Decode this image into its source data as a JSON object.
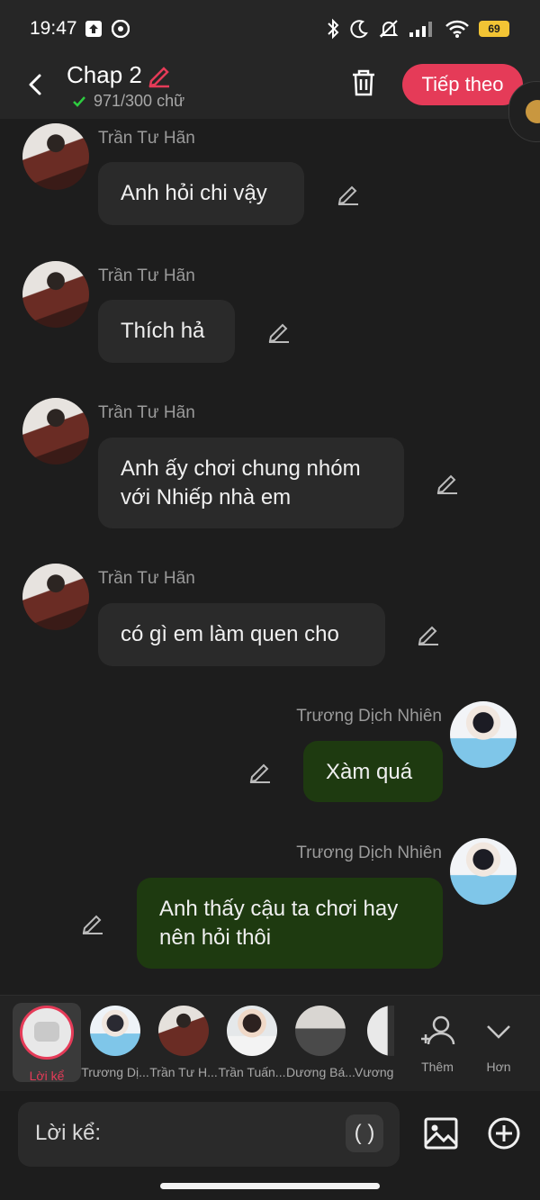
{
  "status_bar": {
    "time": "19:47",
    "battery": "69"
  },
  "header": {
    "title": "Chap 2",
    "word_count": "971/300 chữ",
    "next_label": "Tiếp theo"
  },
  "messages": [
    {
      "sender": "Trần Tư Hãn",
      "text": "Anh hỏi chi vậy",
      "side": "left"
    },
    {
      "sender": "Trần Tư Hãn",
      "text": "Thích hả",
      "side": "left"
    },
    {
      "sender": "Trần Tư Hãn",
      "text": "Anh ấy chơi chung nhóm với Nhiếp nhà em",
      "side": "left"
    },
    {
      "sender": "Trần Tư Hãn",
      "text": "có gì em làm quen cho",
      "side": "left"
    },
    {
      "sender": "Trương Dịch Nhiên",
      "text": "Xàm quá",
      "side": "right"
    },
    {
      "sender": "Trương Dịch Nhiên",
      "text": "Anh thấy cậu ta chơi hay nên hỏi thôi",
      "side": "right"
    }
  ],
  "tray": {
    "items": [
      {
        "label": "Lời kể"
      },
      {
        "label": "Trương Dị..."
      },
      {
        "label": "Trần Tư H..."
      },
      {
        "label": "Trần Tuấn..."
      },
      {
        "label": "Dương Bá..."
      },
      {
        "label": "Vương"
      }
    ],
    "add_label": "Thêm",
    "more_label": "Hơn"
  },
  "composer": {
    "label": "Lời kể:",
    "paren_button": "( )"
  },
  "colors": {
    "accent": "#e53b58",
    "bubble_dark": "#2a2a2a",
    "bubble_green": "#1e3a10",
    "background": "#1d1d1d"
  }
}
